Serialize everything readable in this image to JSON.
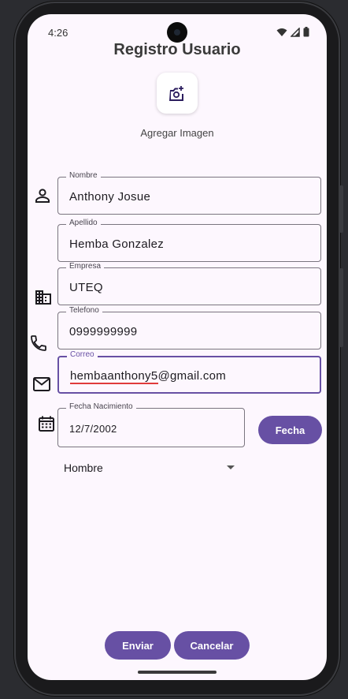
{
  "status": {
    "time": "4:26"
  },
  "title": "Registro Usuario",
  "image_button": {
    "icon": "add-photo-icon",
    "label": "Agregar Imagen"
  },
  "fields": {
    "nombre": {
      "label": "Nombre",
      "value": "Anthony Josue"
    },
    "apellido": {
      "label": "Apellido",
      "value": "Hemba Gonzalez"
    },
    "empresa": {
      "label": "Empresa",
      "value": "UTEQ"
    },
    "telefono": {
      "label": "Telefono",
      "value": "0999999999"
    },
    "correo": {
      "label": "Correo",
      "value_misspelled": "hembaanthony5",
      "value_rest": "@gmail.com"
    },
    "fecha": {
      "label": "Fecha Nacimiento",
      "value": "12/7/2002"
    }
  },
  "buttons": {
    "fecha": "Fecha",
    "enviar": "Enviar",
    "cancelar": "Cancelar"
  },
  "gender_select": {
    "selected": "Hombre"
  },
  "colors": {
    "accent": "#6750a4",
    "background": "#fdf7fe",
    "error_underline": "#e03b3b"
  },
  "icons": [
    "person-icon",
    "business-icon",
    "phone-icon",
    "mail-icon",
    "calendar-icon"
  ]
}
